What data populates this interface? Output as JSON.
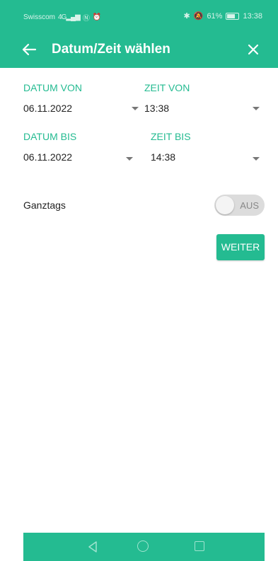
{
  "status_bar": {
    "carrier": "Swisscom",
    "network": "4G",
    "battery_percent": "61%",
    "time": "13:38"
  },
  "app_bar": {
    "title": "Datum/Zeit wählen",
    "back_icon": "arrow-left-icon",
    "close_icon": "close-icon"
  },
  "form": {
    "date_from": {
      "label": "DATUM VON",
      "value": "06.11.2022"
    },
    "time_from": {
      "label": "ZEIT VON",
      "value": "13:38"
    },
    "date_to": {
      "label": "DATUM BIS",
      "value": "06.11.2022"
    },
    "time_to": {
      "label": "ZEIT BIS",
      "value": "14:38"
    },
    "all_day": {
      "label": "Ganztags",
      "toggle_state": "AUS"
    },
    "continue_label": "WEITER"
  },
  "colors": {
    "accent": "#24bb91",
    "text": "#222222",
    "toggle_off": "#dcdcdc"
  }
}
